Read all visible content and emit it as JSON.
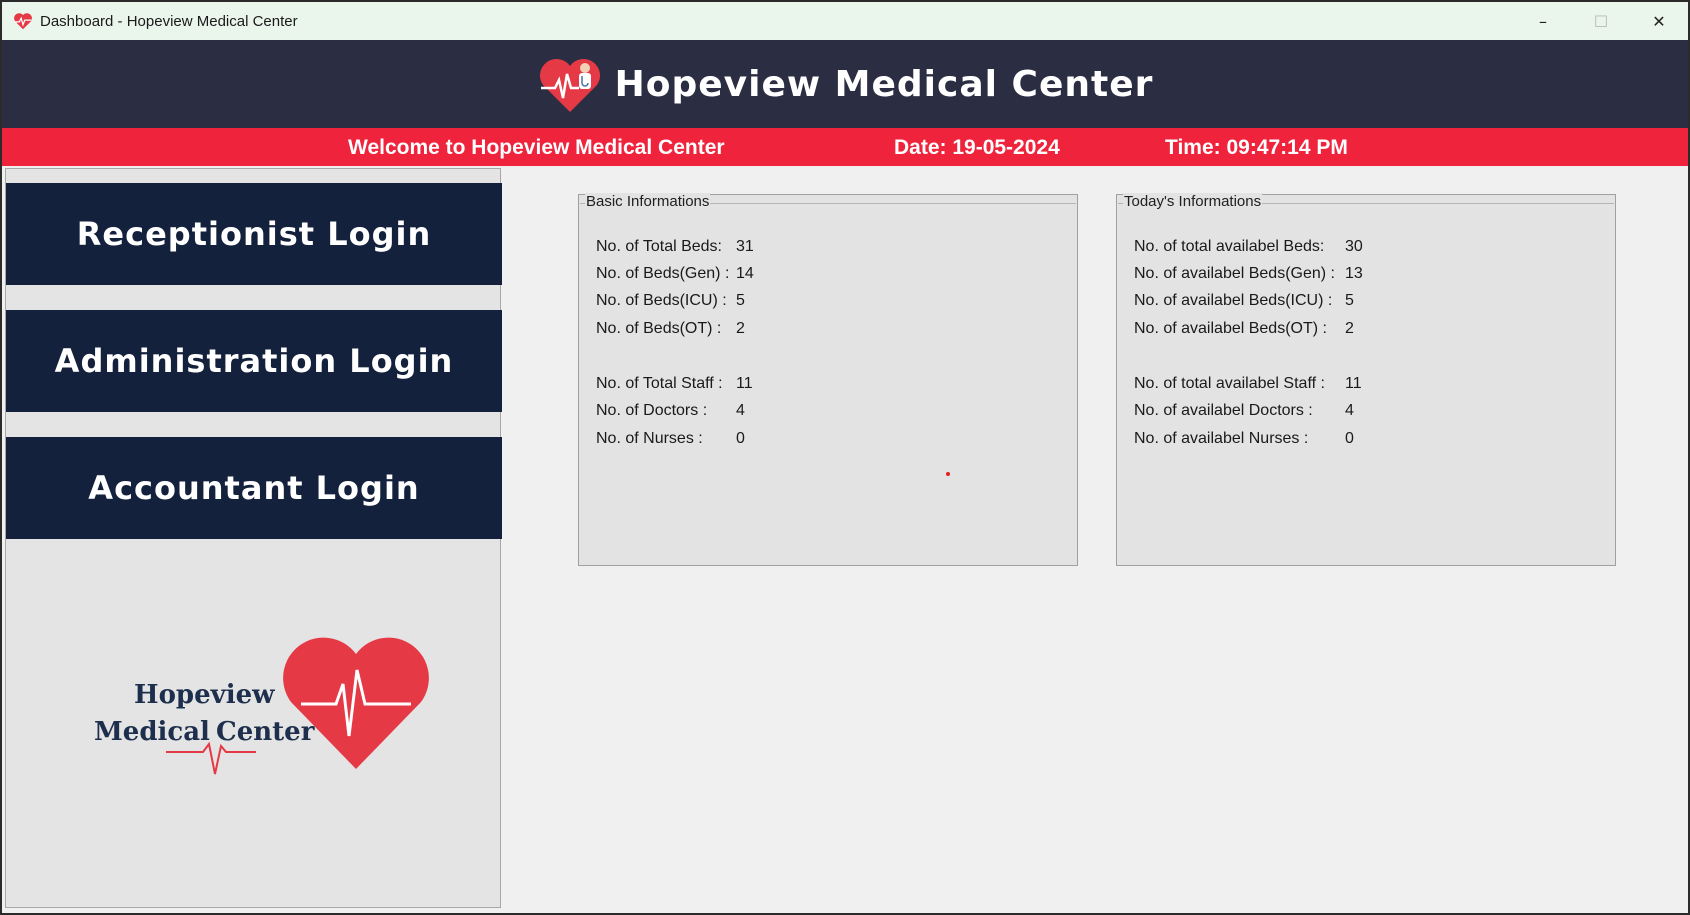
{
  "window": {
    "title": "Dashboard - Hopeview Medical Center",
    "controls": {
      "minimize": "–",
      "maximize": "☐",
      "close": "✕"
    }
  },
  "header": {
    "title": "Hopeview Medical Center"
  },
  "welcome_bar": {
    "welcome": "Welcome to Hopeview Medical Center",
    "date": "Date: 19-05-2024",
    "time": "Time: 09:47:14 PM"
  },
  "sidebar": {
    "buttons": [
      "Receptionist Login",
      "Administration Login",
      "Accountant Login"
    ],
    "logo_text": [
      "Hopeview",
      "Medical",
      "Center"
    ]
  },
  "basic_info": {
    "title": "Basic Informations",
    "rows": [
      {
        "label": "No. of Total Beds:",
        "value": "31"
      },
      {
        "label": "No. of Beds(Gen) :",
        "value": "14"
      },
      {
        "label": "No. of Beds(ICU) :",
        "value": "5"
      },
      {
        "label": "No. of Beds(OT) :",
        "value": "2"
      },
      {
        "label": "No. of Total Staff :",
        "value": "11"
      },
      {
        "label": "No. of Doctors :",
        "value": "4"
      },
      {
        "label": "No. of Nurses :",
        "value": "0"
      }
    ]
  },
  "today_info": {
    "title": "Today's Informations",
    "rows": [
      {
        "label": "No. of total availabel Beds:",
        "value": "30"
      },
      {
        "label": "No. of availabel Beds(Gen) :",
        "value": "13"
      },
      {
        "label": "No. of availabel Beds(ICU) :",
        "value": "5"
      },
      {
        "label": "No. of availabel Beds(OT) :",
        "value": "2"
      },
      {
        "label": "No. of total availabel Staff :",
        "value": "11"
      },
      {
        "label": "No. of availabel Doctors :",
        "value": "4"
      },
      {
        "label": "No. of availabel Nurses :",
        "value": "0"
      }
    ]
  },
  "colors": {
    "header_bg": "#2b2d42",
    "accent_red": "#ef233c",
    "button_bg": "#14213d",
    "logo_navy": "#1d2f4d"
  }
}
